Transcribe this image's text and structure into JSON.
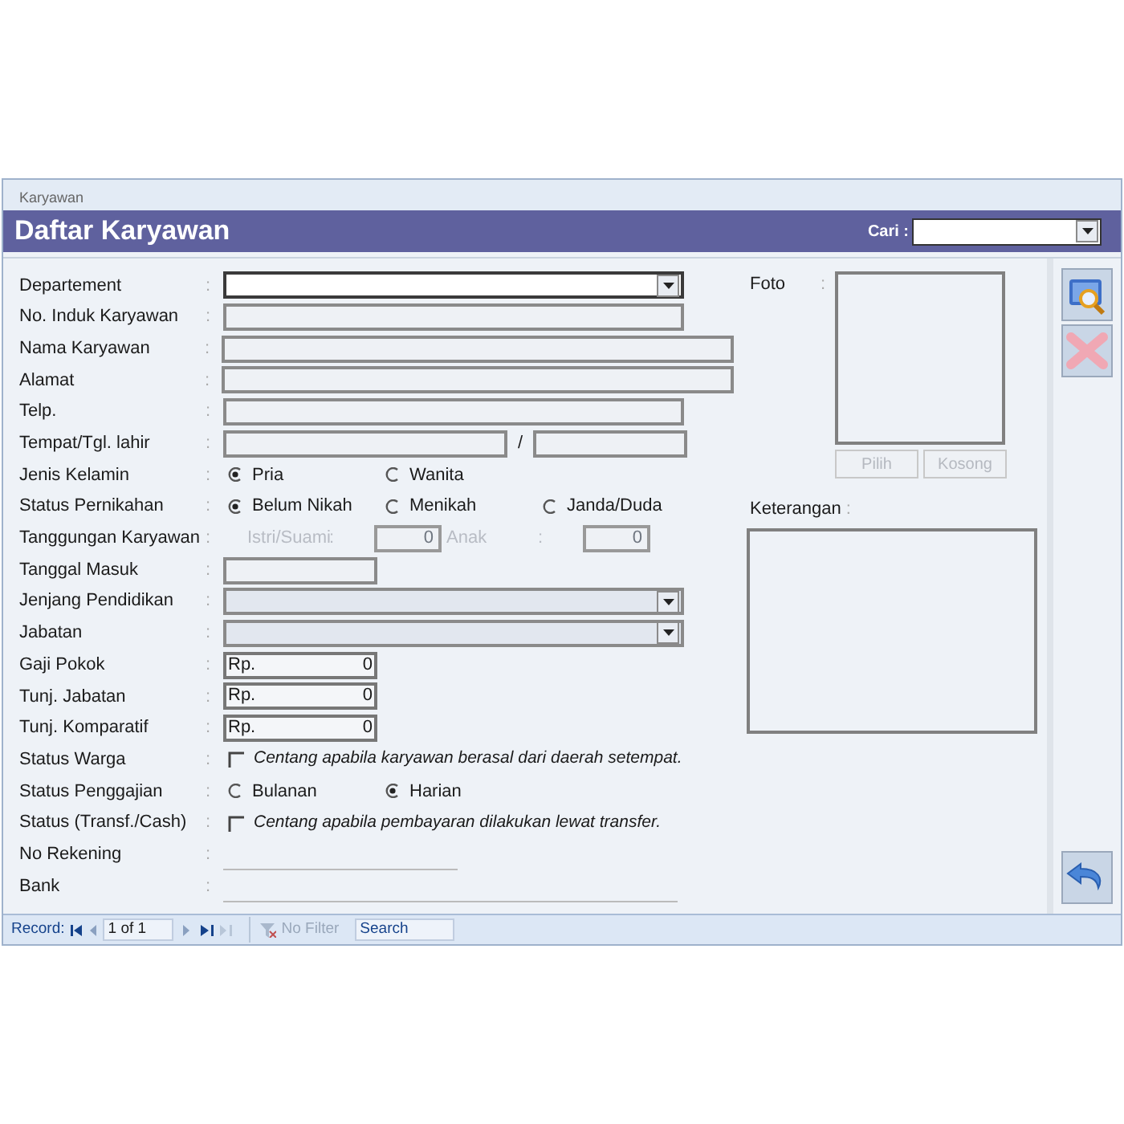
{
  "window": {
    "title": "Karyawan"
  },
  "header": {
    "title": "Daftar Karyawan",
    "search": {
      "label": "Cari :"
    }
  },
  "form": [
    {
      "kind": "combo",
      "label": "Departement",
      "colon": ":",
      "focused": true
    },
    {
      "kind": "text",
      "label": "No. Induk Karyawan",
      "colon": ":"
    },
    {
      "kind": "text",
      "label": "Nama Karyawan",
      "colon": ":"
    },
    {
      "kind": "text",
      "label": "Alamat",
      "colon": ":"
    },
    {
      "kind": "text",
      "label": "Telp.",
      "colon": ":"
    },
    {
      "kind": "pair",
      "label": "Tempat/Tgl. lahir",
      "colon": ":",
      "separator": "/"
    },
    {
      "kind": "radio",
      "label": "Jenis Kelamin",
      "colon": ":",
      "options": [
        {
          "label": "Pria",
          "selected": true
        },
        {
          "label": "Wanita",
          "selected": false
        }
      ]
    },
    {
      "kind": "radio",
      "label": "Status Pernikahan",
      "colon": ":",
      "options": [
        {
          "label": "Belum Nikah",
          "selected": true
        },
        {
          "label": "Menikah",
          "selected": false
        },
        {
          "label": "Janda/Duda",
          "selected": false
        }
      ]
    },
    {
      "kind": "dependents",
      "label": "Tanggungan Karyawan",
      "colon": ":",
      "disabled": true,
      "parts": [
        {
          "label": "Istri/Suami",
          "colon": ":",
          "value": "0"
        },
        {
          "label": "Anak",
          "colon": ":",
          "value": "0"
        }
      ]
    },
    {
      "kind": "text",
      "label": "Tanggal Masuk",
      "colon": ":"
    },
    {
      "kind": "combo",
      "label": "Jenjang Pendidikan",
      "colon": ":",
      "focused": false
    },
    {
      "kind": "combo",
      "label": "Jabatan",
      "colon": ":",
      "focused": false
    },
    {
      "kind": "currency",
      "label": "Gaji Pokok",
      "colon": ":",
      "prefix": "Rp.",
      "value": "0"
    },
    {
      "kind": "currency",
      "label": "Tunj. Jabatan",
      "colon": ":",
      "prefix": "Rp.",
      "value": "0"
    },
    {
      "kind": "currency",
      "label": "Tunj. Komparatif",
      "colon": ":",
      "prefix": "Rp.",
      "value": "0"
    },
    {
      "kind": "checkbox",
      "label": "Status Warga",
      "colon": ":",
      "checked": false,
      "text": "Centang apabila karyawan berasal dari daerah setempat."
    },
    {
      "kind": "radio",
      "label": "Status Penggajian",
      "colon": ":",
      "options": [
        {
          "label": "Bulanan",
          "selected": false
        },
        {
          "label": "Harian",
          "selected": true
        }
      ]
    },
    {
      "kind": "checkbox",
      "label": "Status (Transf./Cash)",
      "colon": ":",
      "checked": false,
      "text": "Centang apabila pembayaran dilakukan lewat transfer."
    },
    {
      "kind": "line",
      "label": "No Rekening",
      "colon": ":"
    },
    {
      "kind": "line",
      "label": "Bank",
      "colon": ":"
    }
  ],
  "photo": {
    "label": "Foto",
    "colon": ":",
    "buttons": [
      {
        "label": "Pilih",
        "disabled": true
      },
      {
        "label": "Kosong",
        "disabled": true
      }
    ]
  },
  "notes": {
    "label": "Keterangan",
    "colon": ":"
  },
  "record_bar": {
    "label": "Record:",
    "position": "1 of 1",
    "filter": {
      "label": "No Filter",
      "disabled": true
    },
    "search": {
      "placeholder": "Search"
    }
  }
}
